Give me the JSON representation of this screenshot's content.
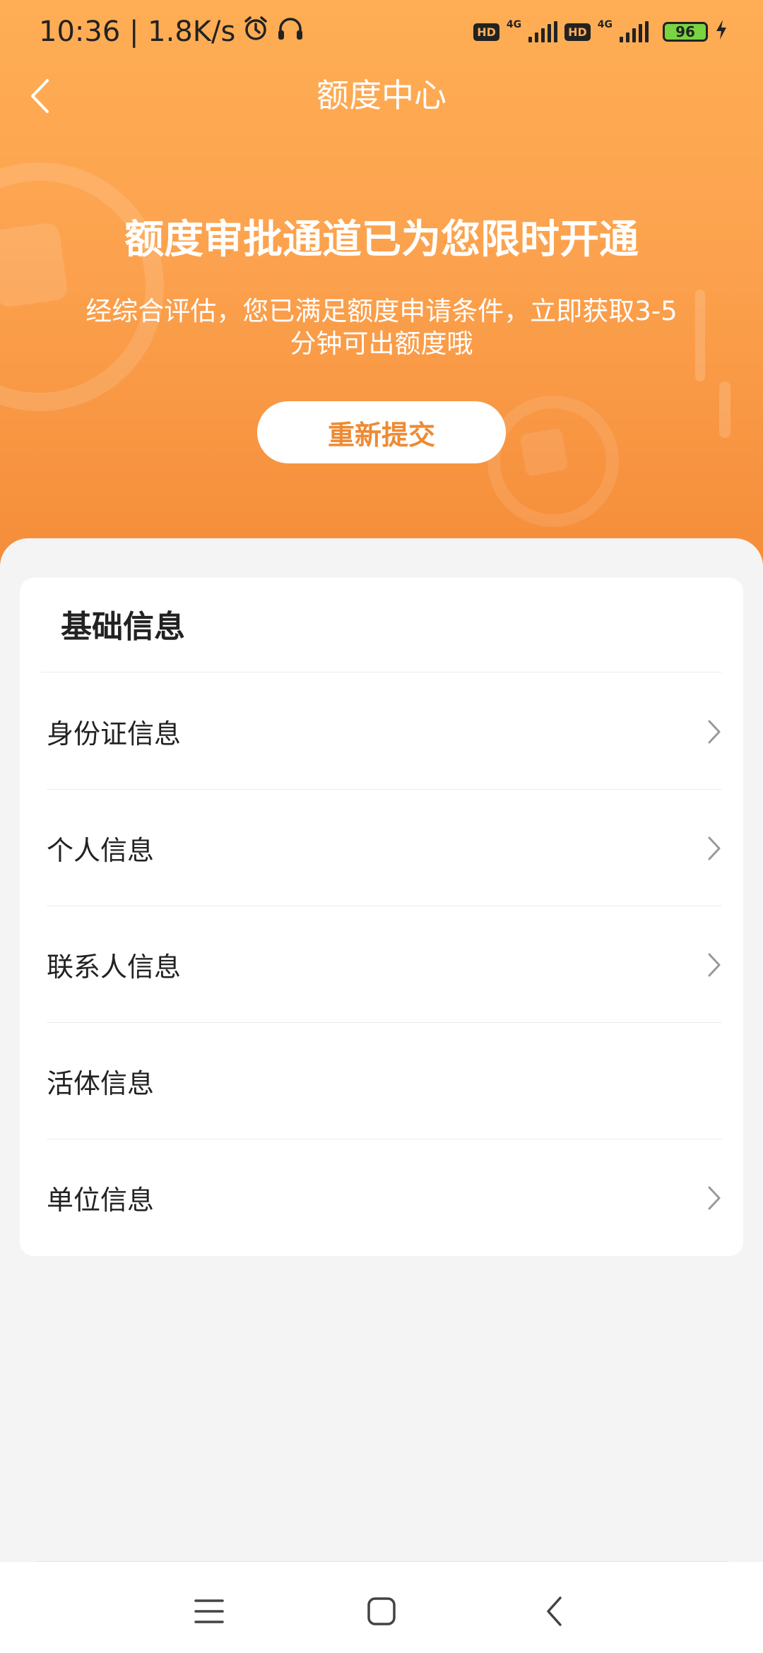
{
  "status_bar": {
    "time_speed": "10:36 | 1.8K/s",
    "hd_badge_1": "HD",
    "network_1": "4G",
    "hd_badge_2": "HD",
    "network_2": "4G",
    "battery": "96"
  },
  "nav": {
    "title": "额度中心"
  },
  "hero": {
    "headline": "额度审批通道已为您限时开通",
    "subtitle": "经综合评估，您已满足额度申请条件，立即获取3-5分钟可出额度哦",
    "button_label": "重新提交"
  },
  "card": {
    "title": "基础信息",
    "rows": [
      {
        "label": "身份证信息",
        "has_chevron": true
      },
      {
        "label": "个人信息",
        "has_chevron": true
      },
      {
        "label": "联系人信息",
        "has_chevron": true
      },
      {
        "label": "活体信息",
        "has_chevron": false
      },
      {
        "label": "单位信息",
        "has_chevron": true
      }
    ]
  },
  "colors": {
    "header_top": "#ffae55",
    "header_bottom": "#f58d3a",
    "accent_text": "#ee8a34"
  },
  "icons": {
    "back": "chevron-left-icon",
    "row_chevron": "chevron-right-icon",
    "alarm": "alarm-icon",
    "headphones": "headphones-icon",
    "charging": "bolt-icon",
    "sys_menu": "menu-icon",
    "sys_home": "home-square-icon",
    "sys_back": "back-triangle-icon"
  }
}
